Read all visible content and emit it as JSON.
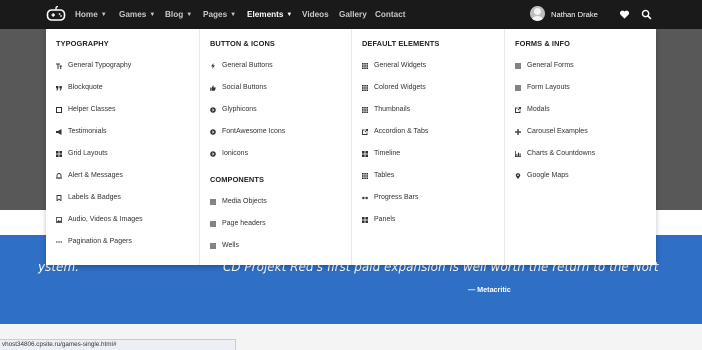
{
  "navbar": {
    "items": [
      {
        "label": "Home",
        "has_caret": true
      },
      {
        "label": "Games",
        "has_caret": true
      },
      {
        "label": "Blog",
        "has_caret": true
      },
      {
        "label": "Pages",
        "has_caret": true
      },
      {
        "label": "Elements",
        "has_caret": true,
        "active": true
      },
      {
        "label": "Videos",
        "has_caret": false
      },
      {
        "label": "Gallery",
        "has_caret": false
      },
      {
        "label": "Contact",
        "has_caret": false
      }
    ],
    "user_name": "Nathan Drake",
    "icons": [
      "gamepad-logo-icon",
      "heart-icon",
      "search-icon"
    ],
    "caret_glyph": "▼"
  },
  "mega_menu": {
    "columns": [
      {
        "sections": [
          {
            "heading": "TYPOGRAPHY",
            "items": [
              {
                "label": "General Typography",
                "icon": "text-size-icon"
              },
              {
                "label": "Blockquote",
                "icon": "quote-icon"
              },
              {
                "label": "Helper Classes",
                "icon": "square-outline-icon"
              },
              {
                "label": "Testimonials",
                "icon": "bullhorn-icon"
              },
              {
                "label": "Grid Layouts",
                "icon": "grid-icon"
              },
              {
                "label": "Alert & Messages",
                "icon": "bell-icon"
              },
              {
                "label": "Labels & Badges",
                "icon": "bookmark-icon"
              },
              {
                "label": "Audio, Videos & Images",
                "icon": "image-icon"
              },
              {
                "label": "Pagination & Pagers",
                "icon": "ellipsis-icon"
              }
            ]
          }
        ]
      },
      {
        "sections": [
          {
            "heading": "BUTTON & ICONS",
            "items": [
              {
                "label": "General Buttons",
                "icon": "bolt-icon"
              },
              {
                "label": "Social Buttons",
                "icon": "thumbs-up-icon"
              },
              {
                "label": "Glyphicons",
                "icon": "circle-icon"
              },
              {
                "label": "FontAwesome Icons",
                "icon": "circle-icon"
              },
              {
                "label": "Ionicons",
                "icon": "circle-icon"
              }
            ]
          },
          {
            "heading": "COMPONENTS",
            "items": [
              {
                "label": "Media Objects",
                "icon": "list-icon"
              },
              {
                "label": "Page headers",
                "icon": "list-icon"
              },
              {
                "label": "Wells",
                "icon": "list-icon"
              }
            ]
          }
        ]
      },
      {
        "sections": [
          {
            "heading": "DEFAULT ELEMENTS",
            "items": [
              {
                "label": "General Widgets",
                "icon": "grid-icon"
              },
              {
                "label": "Colored Widgets",
                "icon": "grid-icon"
              },
              {
                "label": "Thumbnails",
                "icon": "grid-icon"
              },
              {
                "label": "Accordion & Tabs",
                "icon": "external-link-icon"
              },
              {
                "label": "Timeline",
                "icon": "grid-icon"
              },
              {
                "label": "Tables",
                "icon": "grid-icon"
              },
              {
                "label": "Progress Bars",
                "icon": "arrows-horizontal-icon"
              },
              {
                "label": "Panels",
                "icon": "grid-icon"
              }
            ]
          }
        ]
      },
      {
        "sections": [
          {
            "heading": "FORMS & INFO",
            "items": [
              {
                "label": "General Forms",
                "icon": "list-icon"
              },
              {
                "label": "Form Layouts",
                "icon": "list-icon"
              },
              {
                "label": "Modals",
                "icon": "external-link-icon"
              },
              {
                "label": "Carousel Examples",
                "icon": "move-icon"
              },
              {
                "label": "Charts & Countdowns",
                "icon": "bar-chart-icon"
              },
              {
                "label": "Google Maps",
                "icon": "map-marker-icon"
              }
            ]
          }
        ]
      }
    ]
  },
  "quote_band": {
    "left_fragment": "ystem.",
    "main_quote": "CD Projekt Red's first paid expansion is well worth the return to the Nort",
    "source": "— Metacritic"
  },
  "status_bar": {
    "url": "vhost34806.cpsite.ru/games-single.html#"
  },
  "colors": {
    "navbar_bg": "#1a1a1a",
    "accent_blue": "#2f6fc6",
    "hero_gray": "#585858"
  }
}
